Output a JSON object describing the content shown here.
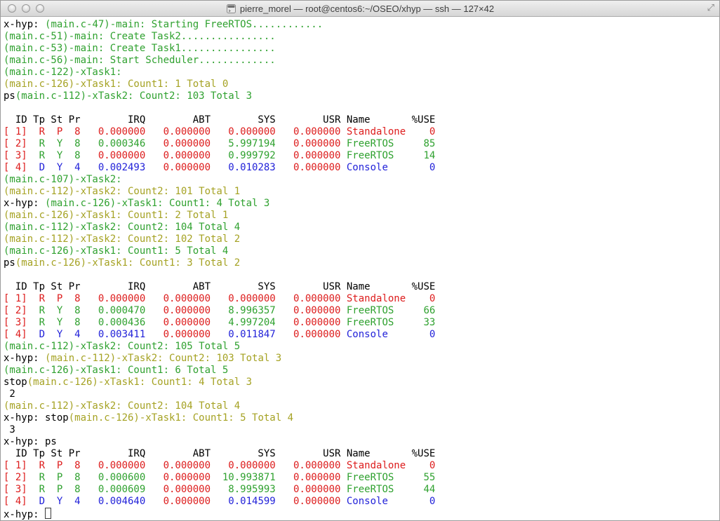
{
  "window": {
    "title": "pierre_morel — root@centos6:~/OSEO/xhyp — ssh — 127×42",
    "fullscreen_glyph": "⤢"
  },
  "palette": {
    "black": "#000000",
    "green": "#2fa12f",
    "olive": "#a5a223",
    "red": "#dd1c1c",
    "blue": "#2222d9"
  },
  "terminal": {
    "prompt": "x-hyp:",
    "lines": [
      {
        "segments": [
          {
            "t": "x-hyp: ",
            "c": "black"
          },
          {
            "t": "(main.c-47)-main: Starting FreeRTOS............",
            "c": "green"
          }
        ]
      },
      {
        "segments": [
          {
            "t": "(main.c-51)-main: Create Task2................",
            "c": "green"
          }
        ]
      },
      {
        "segments": [
          {
            "t": "(main.c-53)-main: Create Task1................",
            "c": "green"
          }
        ]
      },
      {
        "segments": [
          {
            "t": "(main.c-56)-main: Start Scheduler.............",
            "c": "green"
          }
        ]
      },
      {
        "segments": [
          {
            "t": "(main.c-122)-xTask1:",
            "c": "green"
          }
        ]
      },
      {
        "segments": [
          {
            "t": "(main.c-126)-xTask1: Count1: 1 Total 0",
            "c": "olive"
          }
        ]
      },
      {
        "segments": [
          {
            "t": "ps",
            "c": "black"
          },
          {
            "t": "(main.c-112)-xTask2: Count2: 103 Total 3",
            "c": "green"
          }
        ]
      },
      {
        "segments": []
      },
      {
        "segments": [
          {
            "t": "  ID Tp St Pr        IRQ        ABT        SYS        USR Name       %USE",
            "c": "black"
          }
        ]
      },
      {
        "segments": [
          {
            "t": "[ 1]  R  P  8   0.000000   0.000000   0.000000   0.000000 Standalone    0",
            "c": "red"
          }
        ]
      },
      {
        "segments": [
          {
            "t": "[ 2]",
            "c": "red"
          },
          {
            "t": "  R  Y  8   0.000346",
            "c": "green"
          },
          {
            "t": "   0.000000",
            "c": "red"
          },
          {
            "t": "   5.997194",
            "c": "green"
          },
          {
            "t": "   0.000000",
            "c": "red"
          },
          {
            "t": " FreeRTOS     85",
            "c": "green"
          }
        ]
      },
      {
        "segments": [
          {
            "t": "[ 3]",
            "c": "red"
          },
          {
            "t": "  R  Y  8",
            "c": "green"
          },
          {
            "t": "   0.000000   0.000000",
            "c": "red"
          },
          {
            "t": "   0.999792",
            "c": "green"
          },
          {
            "t": "   0.000000",
            "c": "red"
          },
          {
            "t": " FreeRTOS     14",
            "c": "green"
          }
        ]
      },
      {
        "segments": [
          {
            "t": "[ 4]",
            "c": "red"
          },
          {
            "t": "  D  Y  4   0.002493",
            "c": "blue"
          },
          {
            "t": "   0.000000",
            "c": "red"
          },
          {
            "t": "   0.010283",
            "c": "blue"
          },
          {
            "t": "   0.000000",
            "c": "red"
          },
          {
            "t": " Console       0",
            "c": "blue"
          }
        ]
      },
      {
        "segments": [
          {
            "t": "(main.c-107)-xTask2:",
            "c": "green"
          }
        ]
      },
      {
        "segments": [
          {
            "t": "(main.c-112)-xTask2: Count2: 101 Total 1",
            "c": "olive"
          }
        ]
      },
      {
        "segments": [
          {
            "t": "x-hyp: ",
            "c": "black"
          },
          {
            "t": "(main.c-126)-xTask1: Count1: 4 Total 3",
            "c": "green"
          }
        ]
      },
      {
        "segments": [
          {
            "t": "(main.c-126)-xTask1: Count1: 2 Total 1",
            "c": "olive"
          }
        ]
      },
      {
        "segments": [
          {
            "t": "(main.c-112)-xTask2: Count2: 104 Total 4",
            "c": "green"
          }
        ]
      },
      {
        "segments": [
          {
            "t": "(main.c-112)-xTask2: Count2: 102 Total 2",
            "c": "olive"
          }
        ]
      },
      {
        "segments": [
          {
            "t": "(main.c-126)-xTask1: Count1: 5 Total 4",
            "c": "green"
          }
        ]
      },
      {
        "segments": [
          {
            "t": "ps",
            "c": "black"
          },
          {
            "t": "(main.c-126)-xTask1: Count1: 3 Total 2",
            "c": "olive"
          }
        ]
      },
      {
        "segments": []
      },
      {
        "segments": [
          {
            "t": "  ID Tp St Pr        IRQ        ABT        SYS        USR Name       %USE",
            "c": "black"
          }
        ]
      },
      {
        "segments": [
          {
            "t": "[ 1]  R  P  8   0.000000   0.000000   0.000000   0.000000 Standalone    0",
            "c": "red"
          }
        ]
      },
      {
        "segments": [
          {
            "t": "[ 2]",
            "c": "red"
          },
          {
            "t": "  R  Y  8   0.000470",
            "c": "green"
          },
          {
            "t": "   0.000000",
            "c": "red"
          },
          {
            "t": "   8.996357",
            "c": "green"
          },
          {
            "t": "   0.000000",
            "c": "red"
          },
          {
            "t": " FreeRTOS     66",
            "c": "green"
          }
        ]
      },
      {
        "segments": [
          {
            "t": "[ 3]",
            "c": "red"
          },
          {
            "t": "  R  Y  8   0.000436",
            "c": "green"
          },
          {
            "t": "   0.000000",
            "c": "red"
          },
          {
            "t": "   4.997204",
            "c": "green"
          },
          {
            "t": "   0.000000",
            "c": "red"
          },
          {
            "t": " FreeRTOS     33",
            "c": "green"
          }
        ]
      },
      {
        "segments": [
          {
            "t": "[ 4]",
            "c": "red"
          },
          {
            "t": "  D  Y  4   0.003411",
            "c": "blue"
          },
          {
            "t": "   0.000000",
            "c": "red"
          },
          {
            "t": "   0.011847",
            "c": "blue"
          },
          {
            "t": "   0.000000",
            "c": "red"
          },
          {
            "t": " Console       0",
            "c": "blue"
          }
        ]
      },
      {
        "segments": [
          {
            "t": "(main.c-112)-xTask2: Count2: 105 Total 5",
            "c": "green"
          }
        ]
      },
      {
        "segments": [
          {
            "t": "x-hyp: ",
            "c": "black"
          },
          {
            "t": "(main.c-112)-xTask2: Count2: 103 Total 3",
            "c": "olive"
          }
        ]
      },
      {
        "segments": [
          {
            "t": "(main.c-126)-xTask1: Count1: 6 Total 5",
            "c": "green"
          }
        ]
      },
      {
        "segments": [
          {
            "t": "stop",
            "c": "black"
          },
          {
            "t": "(main.c-126)-xTask1: Count1: 4 Total 3",
            "c": "olive"
          }
        ]
      },
      {
        "segments": [
          {
            "t": " 2",
            "c": "black"
          }
        ]
      },
      {
        "segments": [
          {
            "t": "(main.c-112)-xTask2: Count2: 104 Total 4",
            "c": "olive"
          }
        ]
      },
      {
        "segments": [
          {
            "t": "x-hyp: stop",
            "c": "black"
          },
          {
            "t": "(main.c-126)-xTask1: Count1: 5 Total 4",
            "c": "olive"
          }
        ]
      },
      {
        "segments": [
          {
            "t": " 3",
            "c": "black"
          }
        ]
      },
      {
        "segments": [
          {
            "t": "x-hyp: ps",
            "c": "black"
          }
        ]
      },
      {
        "segments": [
          {
            "t": "  ID Tp St Pr        IRQ        ABT        SYS        USR Name       %USE",
            "c": "black"
          }
        ]
      },
      {
        "segments": [
          {
            "t": "[ 1]  R  P  8   0.000000   0.000000   0.000000   0.000000 Standalone    0",
            "c": "red"
          }
        ]
      },
      {
        "segments": [
          {
            "t": "[ 2]",
            "c": "red"
          },
          {
            "t": "  R  P  8   0.000600",
            "c": "green"
          },
          {
            "t": "   0.000000",
            "c": "red"
          },
          {
            "t": "  10.993871",
            "c": "green"
          },
          {
            "t": "   0.000000",
            "c": "red"
          },
          {
            "t": " FreeRTOS     55",
            "c": "green"
          }
        ]
      },
      {
        "segments": [
          {
            "t": "[ 3]",
            "c": "red"
          },
          {
            "t": "  R  P  8   0.000609",
            "c": "green"
          },
          {
            "t": "   0.000000",
            "c": "red"
          },
          {
            "t": "   8.995993",
            "c": "green"
          },
          {
            "t": "   0.000000",
            "c": "red"
          },
          {
            "t": " FreeRTOS     44",
            "c": "green"
          }
        ]
      },
      {
        "segments": [
          {
            "t": "[ 4]",
            "c": "red"
          },
          {
            "t": "  D  Y  4   0.004640",
            "c": "blue"
          },
          {
            "t": "   0.000000",
            "c": "red"
          },
          {
            "t": "   0.014599",
            "c": "blue"
          },
          {
            "t": "   0.000000",
            "c": "red"
          },
          {
            "t": " Console       0",
            "c": "blue"
          }
        ]
      },
      {
        "segments": [
          {
            "t": "x-hyp: ",
            "c": "black"
          }
        ],
        "cursor": true
      }
    ]
  }
}
